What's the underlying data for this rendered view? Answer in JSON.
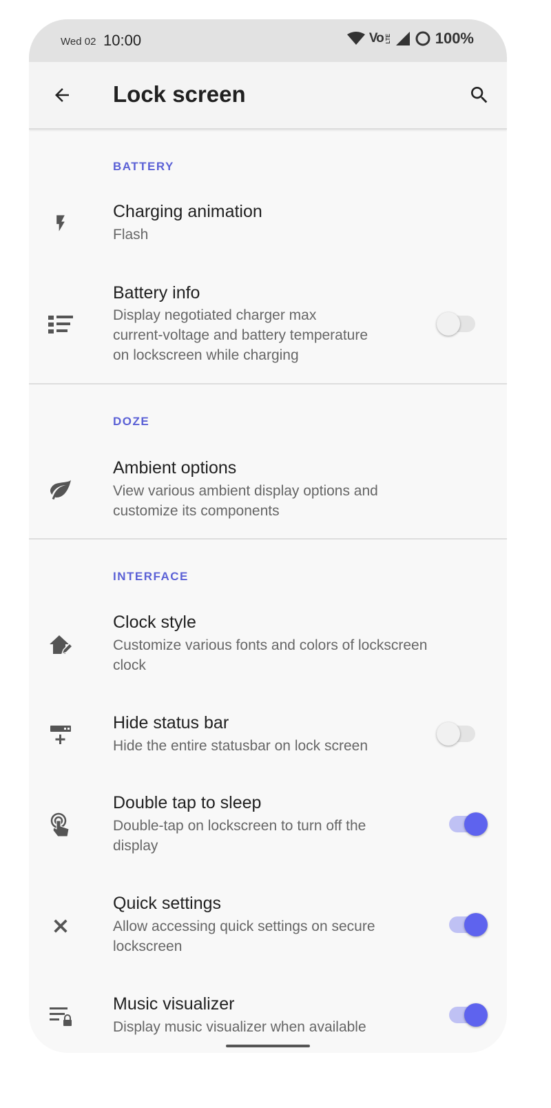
{
  "status_bar": {
    "date": "Wed 02",
    "time": "10:00",
    "volte": "Vo",
    "lte": "LTE",
    "battery": "100%"
  },
  "app_bar": {
    "title": "Lock screen",
    "back_icon": "arrow-back-icon",
    "search_icon": "search-icon"
  },
  "colors": {
    "accent": "#5e63ee",
    "section_header": "#5b61d6",
    "switch_on_track": "#bfc1f4"
  },
  "sections": [
    {
      "header": "BATTERY",
      "items": [
        {
          "title": "Charging animation",
          "subtitle": "Flash",
          "icon": "bolt-icon"
        },
        {
          "title": "Battery info",
          "subtitle_lines": [
            "Display negotiated charger max",
            "current-voltage and battery temperature",
            "on lockscreen while charging"
          ],
          "icon": "list-icon",
          "toggle": false
        }
      ]
    },
    {
      "header": "DOZE",
      "items": [
        {
          "title": "Ambient options",
          "subtitle_lines": [
            "View various ambient display options and",
            "customize its components"
          ],
          "icon": "leaf-icon"
        }
      ]
    },
    {
      "header": "INTERFACE",
      "items": [
        {
          "title": "Clock style",
          "subtitle_lines": [
            "Customize various fonts and colors of lockscreen",
            "clock"
          ],
          "icon": "home-edit-icon"
        },
        {
          "title": "Hide status bar",
          "subtitle": "Hide the entire statusbar on lock screen",
          "icon": "statusbar-add-icon",
          "toggle": false
        },
        {
          "title": "Double tap to sleep",
          "subtitle_lines": [
            "Double-tap on lockscreen to turn off the",
            "display"
          ],
          "icon": "touch-icon",
          "toggle": true
        },
        {
          "title": "Quick settings",
          "subtitle_lines": [
            "Allow accessing quick settings on secure",
            "lockscreen"
          ],
          "icon": "close-icon",
          "toggle": true
        },
        {
          "title": "Music visualizer",
          "subtitle": "Display music visualizer when available",
          "icon": "playlist-lock-icon",
          "toggle": true
        }
      ]
    }
  ]
}
